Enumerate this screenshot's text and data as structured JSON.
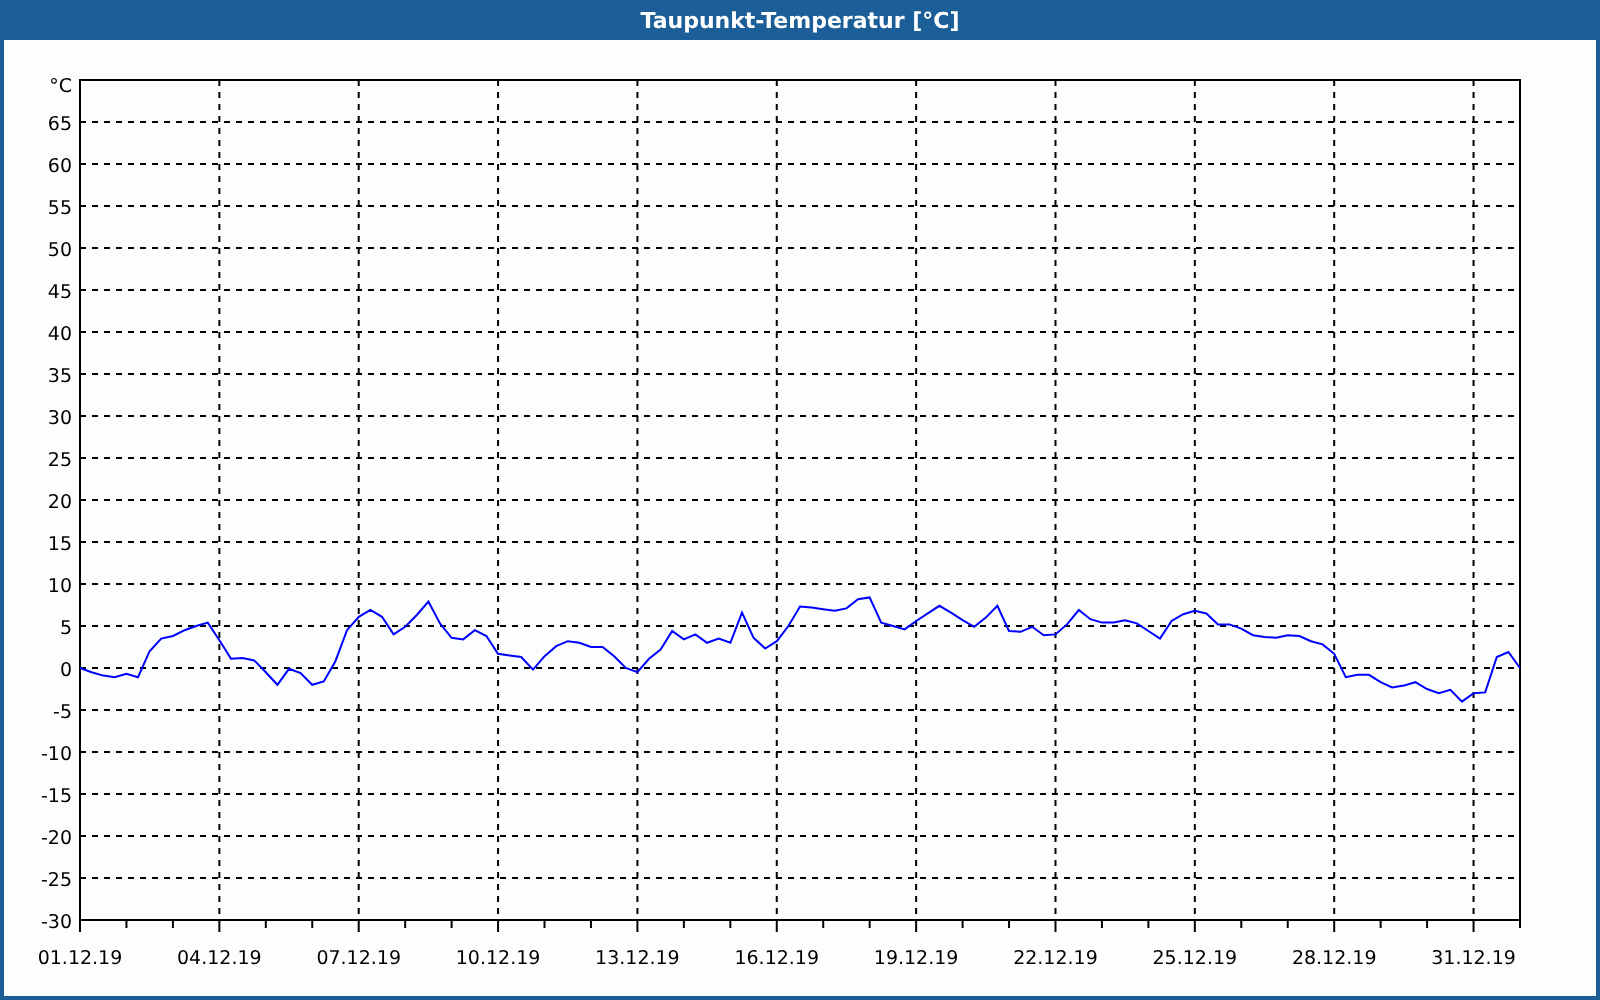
{
  "window": {
    "title": "Taupunkt-Temperatur [°C]"
  },
  "chart": {
    "chart_data": {
      "type": "line",
      "ylabel": "°C",
      "categories": [
        "01.12.19",
        null,
        null,
        null,
        null,
        null,
        null,
        null,
        null,
        null,
        null,
        null,
        "04.12.19",
        null,
        null,
        null,
        null,
        null,
        null,
        null,
        null,
        null,
        null,
        null,
        "07.12.19",
        null,
        null,
        null,
        null,
        null,
        null,
        null,
        null,
        null,
        null,
        null,
        "10.12.19",
        null,
        null,
        null,
        null,
        null,
        null,
        null,
        null,
        null,
        null,
        null,
        "13.12.19",
        null,
        null,
        null,
        null,
        null,
        null,
        null,
        null,
        null,
        null,
        null,
        "16.12.19",
        null,
        null,
        null,
        null,
        null,
        null,
        null,
        null,
        null,
        null,
        null,
        "19.12.19",
        null,
        null,
        null,
        null,
        null,
        null,
        null,
        null,
        null,
        null,
        null,
        "22.12.19",
        null,
        null,
        null,
        null,
        null,
        null,
        null,
        null,
        null,
        null,
        null,
        "25.12.19",
        null,
        null,
        null,
        null,
        null,
        null,
        null,
        null,
        null,
        null,
        null,
        "28.12.19",
        null,
        null,
        null,
        null,
        null,
        null,
        null,
        null,
        null,
        null,
        null,
        "31.12.19",
        null,
        null,
        null,
        null
      ],
      "series": [
        {
          "color": "#0000ff",
          "values": [
            0,
            -0.5,
            -0.9,
            -1.1,
            -0.7,
            -1.1,
            2,
            3.5,
            3.8,
            4.5,
            5,
            5.4,
            3.3,
            1.1,
            1.2,
            0.9,
            -0.5,
            -2,
            -0.1,
            -0.6,
            -2,
            -1.6,
            0.8,
            4.5,
            6.1,
            6.9,
            6.1,
            4,
            4.9,
            6.3,
            7.9,
            5.3,
            3.6,
            3.4,
            4.5,
            3.8,
            1.7,
            1.5,
            1.3,
            -0.2,
            1.4,
            2.6,
            3.2,
            3,
            2.5,
            2.5,
            1.4,
            0,
            -0.5,
            1.1,
            2.2,
            4.4,
            3.4,
            4,
            3,
            3.5,
            3,
            6.6,
            3.6,
            2.3,
            3.2,
            5,
            7.3,
            7.2,
            7,
            6.8,
            7.1,
            8.2,
            8.4,
            5.4,
            5,
            4.6,
            5.6,
            6.5,
            7.4,
            6.6,
            5.7,
            4.9,
            6,
            7.4,
            4.4,
            4.3,
            4.9,
            3.9,
            4,
            5.2,
            6.9,
            5.8,
            5.4,
            5.4,
            5.7,
            5.3,
            4.4,
            3.5,
            5.6,
            6.4,
            6.8,
            6.5,
            5.2,
            5.2,
            4.7,
            3.9,
            3.7,
            3.6,
            3.9,
            3.8,
            3.2,
            2.8,
            1.7,
            -1.1,
            -0.8,
            -0.8,
            -1.7,
            -2.3,
            -2.1,
            -1.7,
            -2.5,
            -3,
            -2.6,
            -4,
            -3,
            -2.9,
            1.3,
            1.9,
            0
          ]
        }
      ],
      "grid": true,
      "ylim": [
        -30,
        70
      ],
      "yticks": [
        -30,
        -25,
        -20,
        -15,
        -10,
        -5,
        0,
        5,
        10,
        15,
        20,
        25,
        30,
        35,
        40,
        45,
        50,
        55,
        60,
        65
      ]
    }
  }
}
